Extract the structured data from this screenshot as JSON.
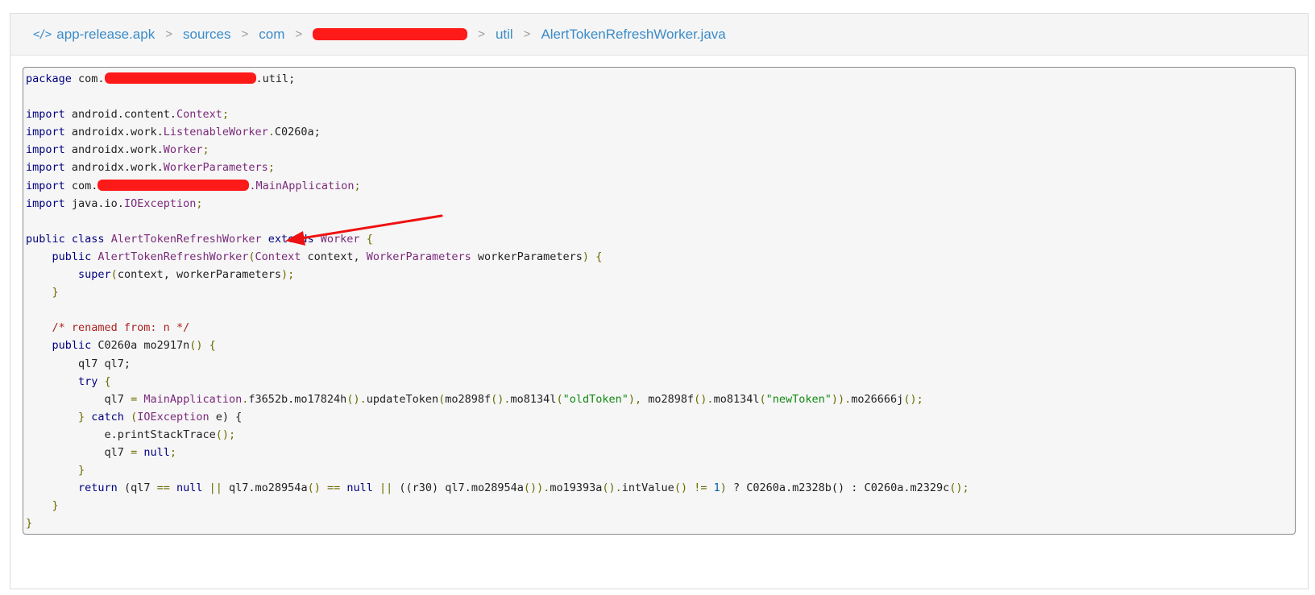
{
  "breadcrumb": {
    "items": [
      "app-release.apk",
      "sources",
      "com",
      "util",
      "AlertTokenRefreshWorker.java"
    ],
    "separator": ">"
  },
  "code": {
    "l1": {
      "a": "package",
      "b": " com.",
      "c": ".util;"
    },
    "i1": {
      "a": "import",
      "b": " android.content.",
      "c": "Context",
      ";": ";"
    },
    "i2": {
      "a": "import",
      "b": " androidx.work.",
      "c": "ListenableWorker",
      ".": ".",
      "d": "C0260a;"
    },
    "i3": {
      "a": "import",
      "b": " androidx.work.",
      "c": "Worker"
    },
    "i4": {
      "a": "import",
      "b": " androidx.work.",
      "c": "WorkerParameters"
    },
    "i5": {
      "a": "import",
      "b": " com.",
      "c": ".MainApplication"
    },
    "i6": {
      "a": "import",
      "b": " java.io.",
      "c": "IOException"
    },
    "cls": {
      "a": "public",
      "b": " class ",
      "c": "AlertTokenRefreshWorker",
      "d": " extends ",
      "e": "Worker",
      "f": " {"
    },
    "ctor": {
      "a": "public",
      "b": " AlertTokenRefreshWorker",
      "c": "(",
      "d": "Context",
      "e": " context, ",
      "f": "WorkerParameters",
      "g": " workerParameters",
      ")": ")",
      "h": " {"
    },
    "sup": {
      "a": "super",
      "b": "(",
      "c": "context, workerParameters",
      "d": ");"
    },
    "cm": "/* renamed from: n */",
    "meth": {
      "a": "public",
      "b": " C0260a mo2917n",
      "c": "() {"
    },
    "decl": "ql7 ql7;",
    "try": {
      "a": "try",
      "b": " {"
    },
    "assign": {
      "a": "ql7 ",
      "b": "=",
      "c": " MainApplication",
      ".": ".",
      "d": "f3652b.mo17824h",
      "e": "().",
      "f": "updateToken",
      "g": "(",
      "h": "mo2898f",
      "i": "().",
      "j": "mo8134l",
      "k": "(",
      "s1": "\"oldToken\"",
      "l": "), ",
      "m": "mo2898f",
      "n": "().",
      "o": "mo8134l",
      "p": "(",
      "s2": "\"newToken\"",
      "q": ")).",
      "r": "mo26666j",
      "t": "();"
    },
    "catch": {
      "a": "} ",
      "b": "catch",
      "c": " (",
      "d": "IOException",
      "e": " e) {"
    },
    "pst": {
      "a": "e.printStackTrace",
      "b": "();"
    },
    "nul": {
      "a": "ql7 ",
      "b": "=",
      "c": " null",
      ";": ";"
    },
    "ret": {
      "a": "return",
      "b": " (ql7 ",
      "c": "==",
      "d": " null ",
      "e": "||",
      "f": " ql7.mo28954a",
      "g": "() ",
      "h": "==",
      "i": " null ",
      "j": "||",
      "k": " ((r30) ql7.mo28954a",
      "l": "()).",
      "m": "mo19393a",
      "n": "().",
      "o": "intValue",
      "p": "() ",
      "q": "!=",
      "r": " 1",
      "s": ")",
      "t": " ? C0260a.m2328b",
      "u": "() : C0260a.m2329c",
      "v": "();"
    }
  },
  "annotation": {
    "color": "#ee1111",
    "redaction_color": "#ff1a1a"
  }
}
